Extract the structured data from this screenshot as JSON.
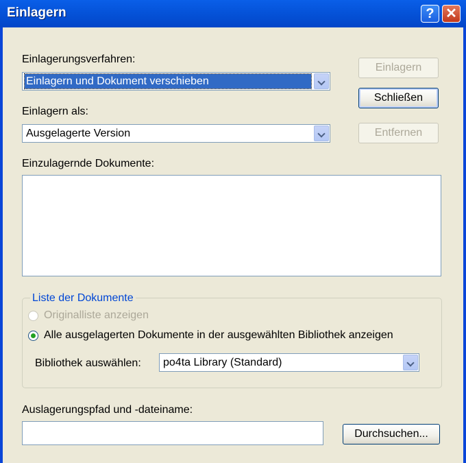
{
  "window": {
    "title": "Einlagern",
    "help": "?",
    "close": "✕"
  },
  "procedure": {
    "label": "Einlagerungsverfahren:",
    "value": "Einlagern und Dokument verschieben"
  },
  "store_as": {
    "label": "Einlagern als:",
    "value": "Ausgelagerte Version"
  },
  "documents": {
    "label": "Einzulagernde Dokumente:"
  },
  "buttons": {
    "einlagern": "Einlagern",
    "schliessen": "Schließen",
    "entfernen": "Entfernen",
    "durchsuchen": "Durchsuchen..."
  },
  "group": {
    "title": "Liste der Dokumente",
    "radio_original": "Originalliste anzeigen",
    "radio_all": "Alle ausgelagerten Dokumente in der ausgewählten Bibliothek anzeigen",
    "library_label": "Bibliothek auswählen:",
    "library_value": "po4ta Library  (Standard)"
  },
  "path": {
    "label": "Auslagerungspfad und -dateiname:",
    "value": ""
  }
}
